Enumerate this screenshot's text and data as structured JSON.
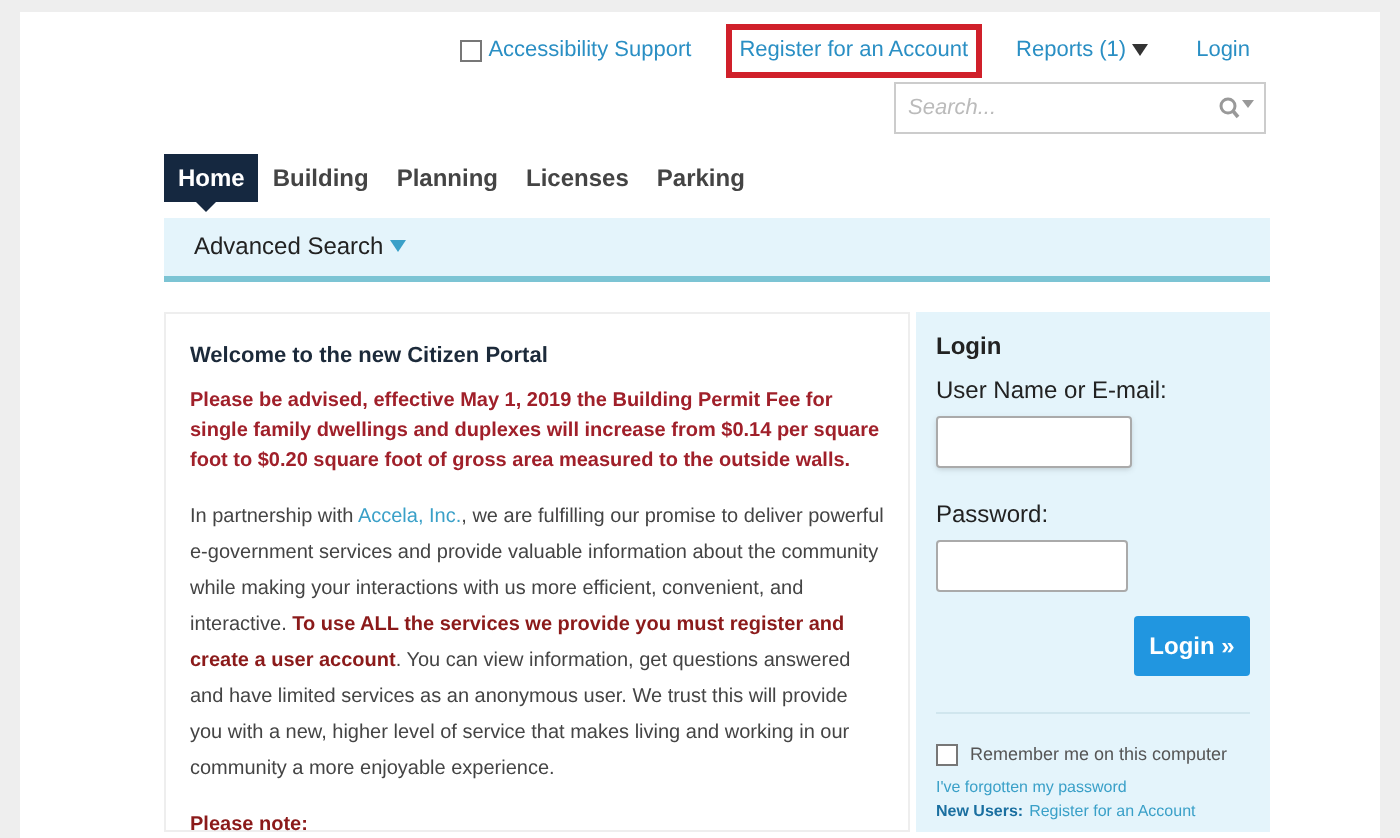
{
  "top_links": [
    {
      "kind": "checkbox",
      "label": "Accessibility Support",
      "checked": false,
      "highlighted": false
    },
    {
      "kind": "link",
      "label": "Register for an Account",
      "highlighted": true
    },
    {
      "kind": "dropdown",
      "label": "Reports (1)",
      "highlighted": false
    },
    {
      "kind": "link",
      "label": "Login",
      "highlighted": false
    }
  ],
  "search": {
    "placeholder": "Search..."
  },
  "tabs": [
    {
      "label": "Home",
      "selected": true
    },
    {
      "label": "Building",
      "selected": false
    },
    {
      "label": "Planning",
      "selected": false
    },
    {
      "label": "Licenses",
      "selected": false
    },
    {
      "label": "Parking",
      "selected": false
    }
  ],
  "sub_nav": {
    "label": "Advanced Search"
  },
  "welcome": {
    "title": "Welcome to the new Citizen Portal",
    "notice": "Please be advised, effective May 1, 2019 the Building Permit Fee for single family dwellings and duplexes will increase from $0.14 per square foot to $0.20 square foot of gross area measured to the outside walls.",
    "intro_before": "In partnership with",
    "intro_link": "Accela, Inc.",
    "intro_after": ", we are fulfilling our promise to deliver powerful e-government services and provide valuable information about the community while making your interactions with us more efficient, convenient, and interactive. **To use ALL the services we provide you must register and create a user account**. You can view information, get questions answered and have limited services as an anonymous user. We trust this will provide you with a new, higher level of service that makes living and working in our community a more enjoyable experience.",
    "note_heading": "Please note:"
  },
  "login": {
    "title": "Login",
    "username_label": "User Name or E-mail:",
    "password_label": "Password:",
    "button": "Login »",
    "remember": {
      "label": "Remember me on this computer",
      "checked": false
    },
    "forgot_link": "I've forgotten my password",
    "new_users_label": "New Users:",
    "register_link": "Register for an Account"
  }
}
